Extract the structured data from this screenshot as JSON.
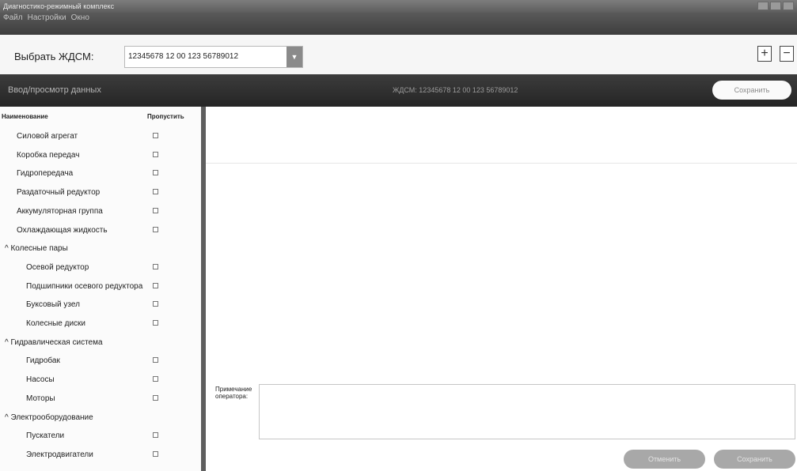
{
  "window": {
    "title": "Диагностико-режимный комплекс"
  },
  "menu": [
    "Файл",
    "Настройки",
    "Окно"
  ],
  "selector": {
    "label": "Выбрать ЖДСМ:",
    "value": "12345678 12 00 123 56789012",
    "add_label": "+",
    "remove_label": "−"
  },
  "data_header": {
    "title": "Ввод/просмотр данных",
    "current": "ЖДСМ: 12345678 12 00 123 56789012",
    "save_label": "Сохранить"
  },
  "list": {
    "col_name": "Наименование",
    "col_skip": "Пропустить",
    "rows": [
      {
        "label": "Силовой агрегат",
        "type": "item"
      },
      {
        "label": "Коробка передач",
        "type": "item"
      },
      {
        "label": "Гидропередача",
        "type": "item"
      },
      {
        "label": "Раздаточный редуктор",
        "type": "item"
      },
      {
        "label": "Аккумуляторная группа",
        "type": "item"
      },
      {
        "label": "Охлаждающая жидкость",
        "type": "item"
      },
      {
        "label": "^ Колесные пары",
        "type": "group"
      },
      {
        "label": "Осевой редуктор",
        "type": "sub"
      },
      {
        "label": "Подшипники осевого редуктора",
        "type": "sub"
      },
      {
        "label": "Буксовый узел",
        "type": "sub"
      },
      {
        "label": "Колесные диски",
        "type": "sub"
      },
      {
        "label": "^ Гидравлическая система",
        "type": "group"
      },
      {
        "label": "Гидробак",
        "type": "sub"
      },
      {
        "label": "Насосы",
        "type": "sub"
      },
      {
        "label": "Моторы",
        "type": "sub"
      },
      {
        "label": "^ Электрооборудование",
        "type": "group"
      },
      {
        "label": "Пускатели",
        "type": "sub"
      },
      {
        "label": "Электродвигатели",
        "type": "sub"
      }
    ]
  },
  "note": {
    "label": "Примечание оператора:"
  },
  "footer": {
    "cancel_label": "Отменить",
    "save_label": "Сохранить"
  }
}
